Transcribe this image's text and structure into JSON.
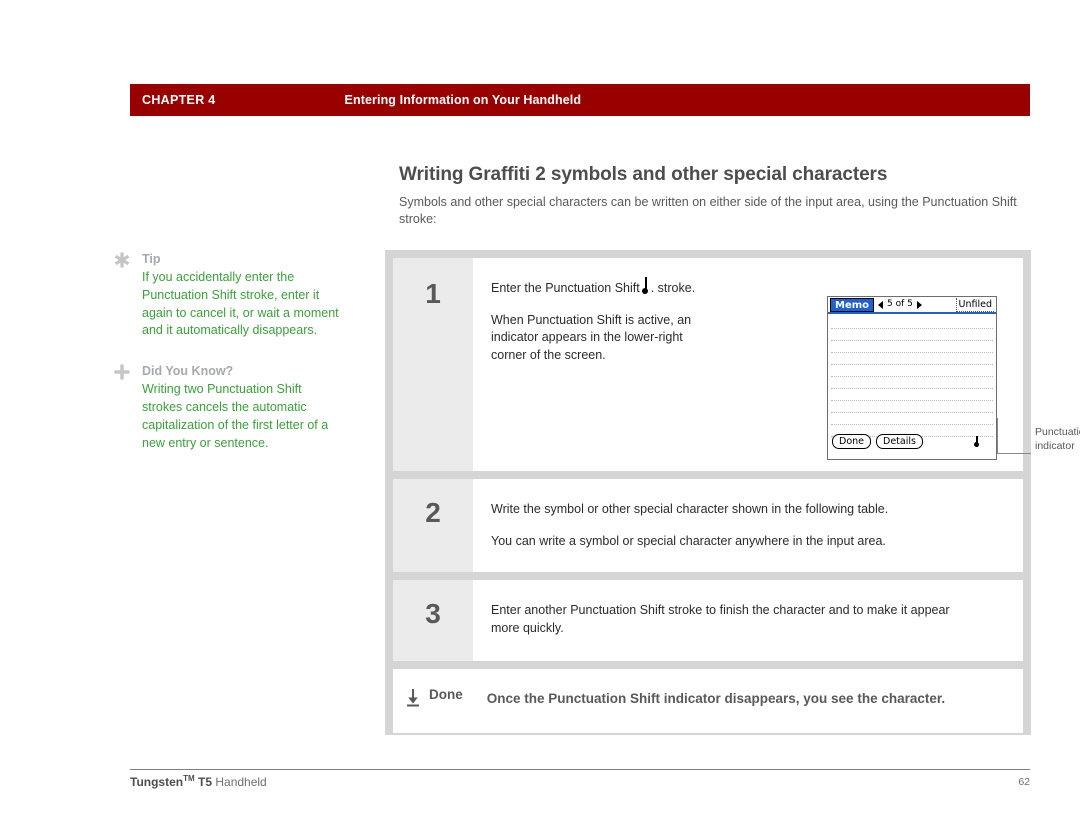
{
  "header": {
    "chapter": "CHAPTER 4",
    "section": "Entering Information on Your Handheld",
    "bar_color": "#990000"
  },
  "page": {
    "title": "Writing Graffiti 2 symbols and other special characters",
    "intro": "Symbols and other special characters can be written on either side of the input area, using the Punctuation Shift stroke:"
  },
  "sidebar": {
    "notes": [
      {
        "icon": "asterisk-icon",
        "title": "Tip",
        "body": "If you accidentally enter the Punctuation Shift stroke, enter it again to cancel it, or wait a moment and it automatically disappears."
      },
      {
        "icon": "plus-icon",
        "title": "Did You Know?",
        "body": "Writing two Punctuation Shift strokes cancels the automatic capitalization of the first letter of a new entry or sentence."
      }
    ],
    "text_color": "#3ba03b",
    "title_color": "#a7a9ac"
  },
  "steps": [
    {
      "number": "1",
      "paragraph_1_before": "Enter the Punctuation Shift",
      "paragraph_1_after": ". stroke.",
      "paragraph_2": "When Punctuation Shift is active, an indicator appears in the lower-right corner of the screen."
    },
    {
      "number": "2",
      "paragraph_1": "Write the symbol or other special character shown in the following table.",
      "paragraph_2": "You can write a symbol or special character anywhere in the input area."
    },
    {
      "number": "3",
      "paragraph_1": "Enter another Punctuation Shift stroke to finish the character and to make it appear more quickly."
    }
  ],
  "done": {
    "icon": "download-arrow-icon",
    "label": "Done",
    "text": "Once the Punctuation Shift indicator disappears, you see the character."
  },
  "pda": {
    "app_name": "Memo",
    "record_nav": "5 of 5",
    "category": "Unfiled",
    "buttons": [
      "Done",
      "Details"
    ],
    "title_color": "#1d62d0",
    "line_count": 10
  },
  "callout": {
    "label_line_1": "Punctuation shift",
    "label_line_2": "indicator"
  },
  "footer": {
    "product_bold": "Tungsten",
    "trademark": "TM",
    "model_bold": " T5",
    "product_rest": " Handheld",
    "page_number": "62"
  }
}
